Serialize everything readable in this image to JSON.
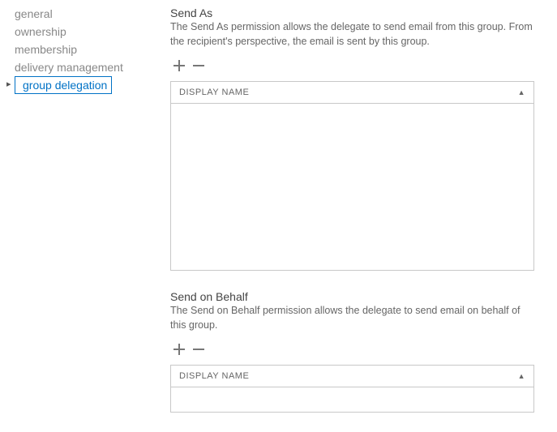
{
  "sidebar": {
    "items": [
      {
        "label": "general",
        "selected": false
      },
      {
        "label": "ownership",
        "selected": false
      },
      {
        "label": "membership",
        "selected": false
      },
      {
        "label": "delivery management",
        "selected": false
      },
      {
        "label": "group delegation",
        "selected": true
      }
    ]
  },
  "sections": {
    "sendAs": {
      "title": "Send As",
      "description": "The Send As permission allows the delegate to send email from this group. From the recipient's perspective, the email is sent by this group.",
      "columnHeader": "DISPLAY NAME",
      "rows": []
    },
    "sendOnBehalf": {
      "title": "Send on Behalf",
      "description": "The Send on Behalf permission allows the delegate to send email on behalf of this group.",
      "columnHeader": "DISPLAY NAME",
      "rows": []
    }
  }
}
